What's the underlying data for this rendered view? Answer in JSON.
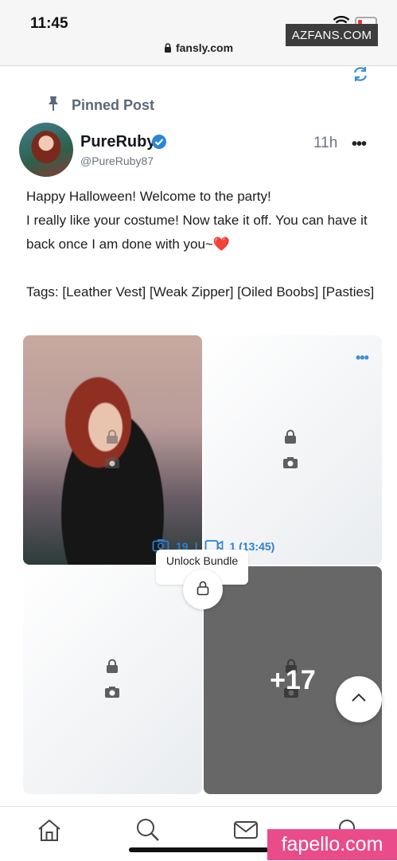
{
  "status_bar": {
    "time": "11:45",
    "battery_color": "#e33333"
  },
  "watermarks": {
    "top": "AZFANS.COM",
    "bottom": "fapello.com"
  },
  "browser": {
    "url": "fansly.com"
  },
  "icons": {
    "refresh": "refresh-icon",
    "pin": "pin-icon",
    "verified": "verified-badge-icon",
    "lock": "lock-icon",
    "camera": "camera-icon",
    "video": "video-icon",
    "chevron_up": "chevron-up-icon",
    "home": "home-icon",
    "search": "search-icon",
    "messages": "mail-icon",
    "notifications": "bell-icon"
  },
  "post": {
    "pinned_label": "Pinned Post",
    "author": {
      "name": "PureRuby",
      "handle": "@PureRuby87"
    },
    "time": "11h",
    "more_label": "•••",
    "lines": [
      "Happy Halloween! Welcome to the party!",
      "I really like your costume! Now take it off. You can have it back once I am done with you~❤️",
      "",
      "Tags: [Leather Vest] [Weak Zipper] [Oiled Boobs] [Pasties]"
    ]
  },
  "media": {
    "tile_more_label": "•••",
    "extra_count": "+17",
    "bundle": {
      "photo_count": "19",
      "separator": "|",
      "video_info": "1 (13:45)",
      "unlock_label": "Unlock Bundle"
    }
  },
  "colors": {
    "accent": "#2a7fd0",
    "muted": "#5d6878",
    "locked_tile": "#676767"
  }
}
